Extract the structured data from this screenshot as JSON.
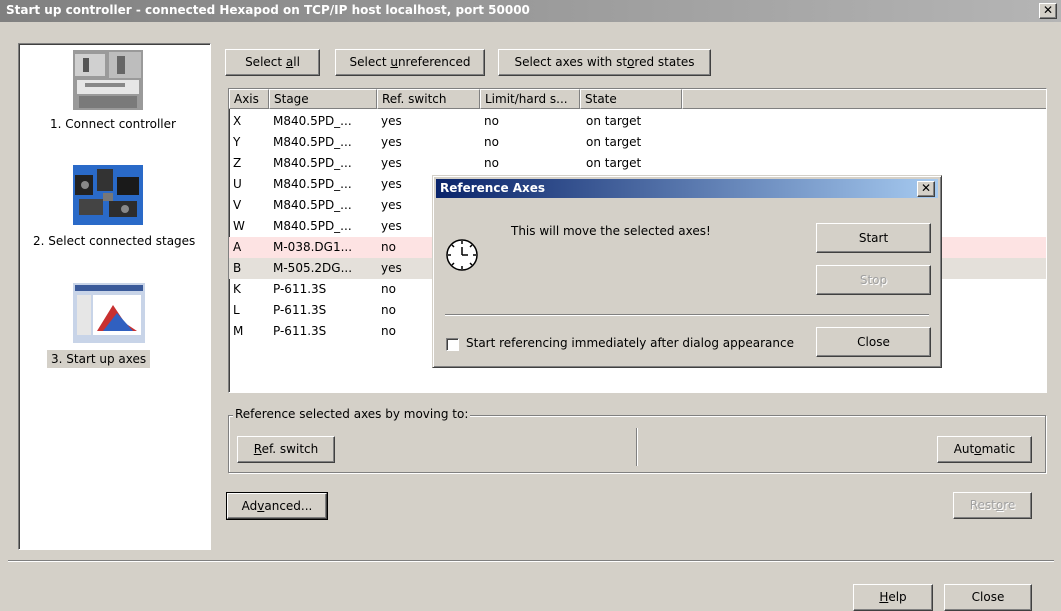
{
  "window": {
    "title": "Start up controller - connected Hexapod on TCP/IP host localhost, port 50000",
    "close_glyph": "✕"
  },
  "sidebar": {
    "steps": [
      {
        "label": "1. Connect controller",
        "icon": "controller-photo-icon"
      },
      {
        "label": "2. Select connected stages",
        "icon": "stages-photo-icon"
      },
      {
        "label": "3. Start up axes",
        "icon": "axes-screenshot-icon"
      }
    ]
  },
  "toolbar": {
    "select_all": {
      "pre": "Select ",
      "u": "a",
      "post": "ll"
    },
    "select_unref": {
      "pre": "Select ",
      "u": "u",
      "post": "nreferenced"
    },
    "select_stored": {
      "pre": "Select axes with st",
      "u": "o",
      "post": "red states"
    }
  },
  "table": {
    "headers": [
      "Axis",
      "Stage",
      "Ref. switch",
      "Limit/hard s...",
      "State"
    ],
    "rows": [
      {
        "axis": "X",
        "stage": "M840.5PD_...",
        "ref": "yes",
        "limit": "no",
        "state": "on target"
      },
      {
        "axis": "Y",
        "stage": "M840.5PD_...",
        "ref": "yes",
        "limit": "no",
        "state": "on target"
      },
      {
        "axis": "Z",
        "stage": "M840.5PD_...",
        "ref": "yes",
        "limit": "no",
        "state": "on target"
      },
      {
        "axis": "U",
        "stage": "M840.5PD_...",
        "ref": "yes",
        "limit": "",
        "state": ""
      },
      {
        "axis": "V",
        "stage": "M840.5PD_...",
        "ref": "yes",
        "limit": "",
        "state": ""
      },
      {
        "axis": "W",
        "stage": "M840.5PD_...",
        "ref": "yes",
        "limit": "",
        "state": ""
      },
      {
        "axis": "A",
        "stage": "M-038.DG1...",
        "ref": "no",
        "limit": "",
        "state": ""
      },
      {
        "axis": "B",
        "stage": "M-505.2DG...",
        "ref": "yes",
        "limit": "",
        "state": ""
      },
      {
        "axis": "K",
        "stage": "P-611.3S",
        "ref": "no",
        "limit": "",
        "state": ""
      },
      {
        "axis": "L",
        "stage": "P-611.3S",
        "ref": "no",
        "limit": "",
        "state": ""
      },
      {
        "axis": "M",
        "stage": "P-611.3S",
        "ref": "no",
        "limit": "",
        "state": ""
      }
    ]
  },
  "colors": {
    "row_a": "#fde3e3",
    "row_b": "#e4e0da"
  },
  "reference_group": {
    "label": "Reference selected axes by moving to:",
    "ref_switch": {
      "pre": "",
      "u": "R",
      "post": "ef. switch"
    },
    "automatic": {
      "pre": "Aut",
      "u": "o",
      "post": "matic"
    }
  },
  "advanced_button": {
    "pre": "Ad",
    "u": "v",
    "post": "anced..."
  },
  "restore_button": {
    "pre": "Rest",
    "u": "o",
    "post": "re"
  },
  "help_button": {
    "pre": "",
    "u": "H",
    "post": "elp"
  },
  "close_button": "Close",
  "dialog": {
    "title": "Reference Axes",
    "message": "This will move the selected axes!",
    "start": "Start",
    "stop": "Stop",
    "close": "Close",
    "checkbox_label": "Start referencing immediately after dialog appearance",
    "icon": "clock-icon"
  }
}
